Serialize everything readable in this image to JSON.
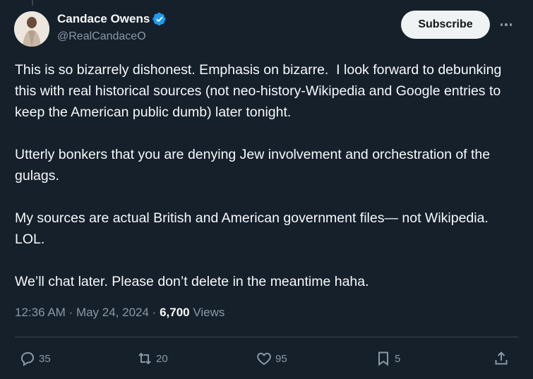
{
  "author": {
    "display_name": "Candace Owens",
    "handle": "@RealCandaceO",
    "verified": true
  },
  "subscribe_label": "Subscribe",
  "tweet": {
    "paragraphs": [
      "This is so bizarrely dishonest. Emphasis on bizarre.  I look forward to debunking this with real historical sources (not neo-history-Wikipedia and Google entries to keep the American public dumb) later tonight.",
      "Utterly bonkers that you are denying Jew involvement and orchestration of the gulags.",
      "My sources are actual British and American government files— not Wikipedia.  LOL.",
      "We’ll chat later. Please don’t delete in the meantime haha."
    ]
  },
  "meta": {
    "time": "12:36 AM",
    "sep1": " · ",
    "date": "May 24, 2024",
    "sep2": " · ",
    "views_count": "6,700",
    "views_label": " Views"
  },
  "actions": {
    "replies": "35",
    "reposts": "20",
    "likes": "95",
    "bookmarks": "5"
  },
  "colors": {
    "background": "#15202b",
    "text": "#f7f9f9",
    "secondary": "#8b98a5",
    "verified": "#1d9bf0",
    "button": "#eff3f4"
  },
  "icons": [
    "verified-badge-icon",
    "more-icon",
    "reply-icon",
    "repost-icon",
    "like-icon",
    "bookmark-icon",
    "share-icon"
  ]
}
